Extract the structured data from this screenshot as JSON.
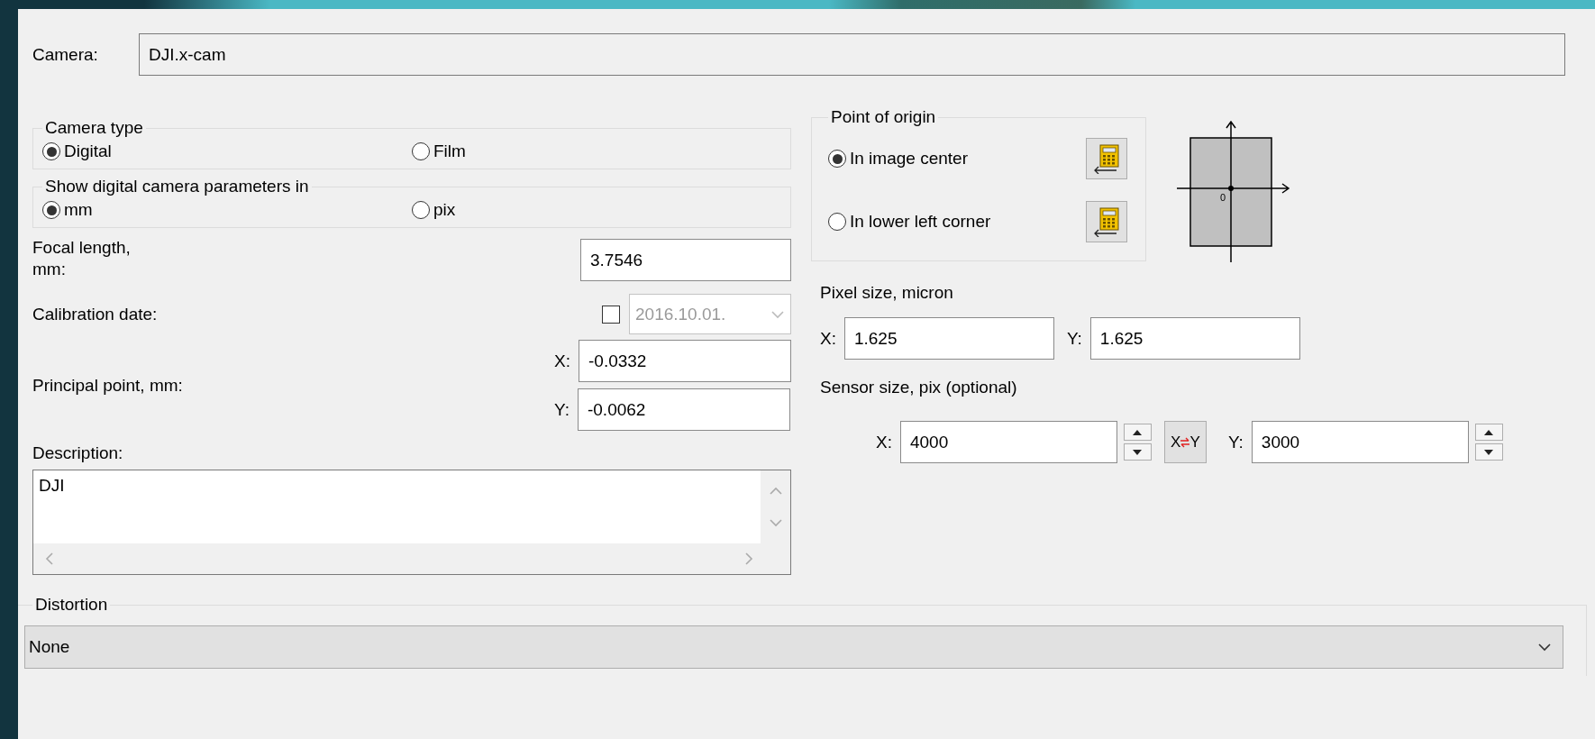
{
  "camera": {
    "label": "Camera:",
    "value": "DJI.x-cam"
  },
  "camera_type": {
    "title": "Camera type",
    "options": [
      {
        "label": "Digital",
        "selected": true
      },
      {
        "label": "Film",
        "selected": false
      }
    ]
  },
  "units": {
    "title": "Show digital camera parameters in",
    "options": [
      {
        "label": "mm",
        "selected": true
      },
      {
        "label": "pix",
        "selected": false
      }
    ]
  },
  "focal_length": {
    "label": "Focal length, mm:",
    "value": "3.7546"
  },
  "calibration_date": {
    "label": "Calibration date:",
    "checked": false,
    "disabled": true,
    "value": "2016.10.01."
  },
  "principal_point": {
    "label": "Principal point, mm:",
    "fields": [
      {
        "label": "X:",
        "value": "-0.0332"
      },
      {
        "label": "Y:",
        "value": "-0.0062"
      }
    ]
  },
  "description": {
    "label": "Description:",
    "value": "DJI"
  },
  "point_of_origin": {
    "title": "Point of origin",
    "options": [
      {
        "label": "In image center",
        "selected": true
      },
      {
        "label": "In lower left corner",
        "selected": false
      }
    ]
  },
  "origin_diagram": {
    "origin_label": "0"
  },
  "pixel_size": {
    "label": "Pixel size, micron",
    "fields": [
      {
        "label": "X:",
        "value": "1.625"
      },
      {
        "label": "Y:",
        "value": "1.625"
      }
    ]
  },
  "sensor_size": {
    "label": "Sensor size, pix (optional)",
    "fields": [
      {
        "label": "X:",
        "value": "4000"
      },
      {
        "label": "Y:",
        "value": "3000"
      }
    ],
    "swap_button": {
      "from": "X",
      "to": "Y"
    }
  },
  "distortion": {
    "title": "Distortion",
    "value": "None"
  }
}
